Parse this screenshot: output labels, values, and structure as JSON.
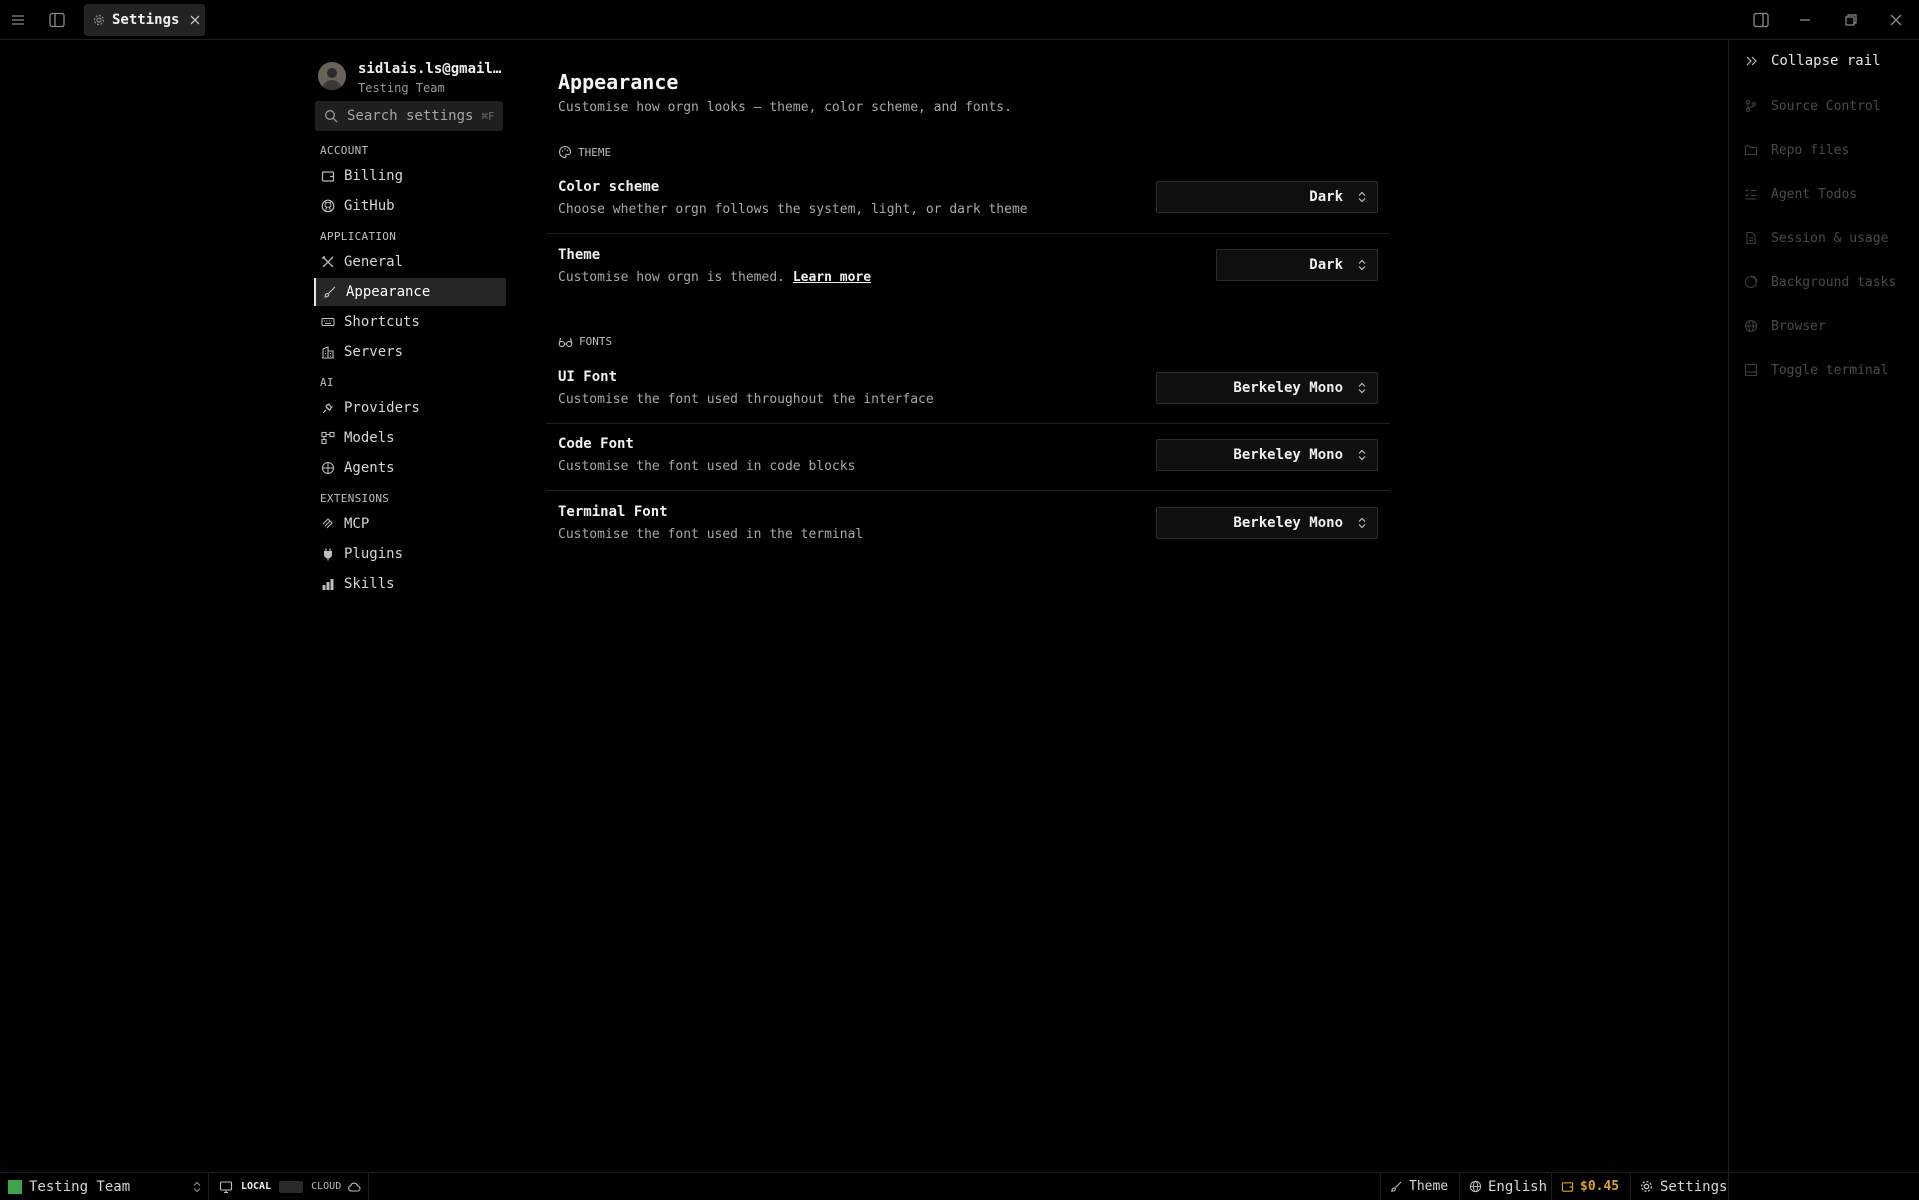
{
  "titlebar": {
    "tab_label": "Settings",
    "icons": [
      "menu-icon",
      "sidebar-toggle-icon",
      "gear-icon",
      "close-icon",
      "panel-right-icon",
      "minimize-icon",
      "restore-icon",
      "window-close-icon"
    ]
  },
  "profile": {
    "email": "sidlais.ls@gmail…",
    "team": "Testing Team"
  },
  "search": {
    "placeholder": "Search settings",
    "shortcut": "⌘F"
  },
  "nav": {
    "account_header": "ACCOUNT",
    "billing": "Billing",
    "github": "GitHub",
    "application_header": "APPLICATION",
    "general": "General",
    "appearance": "Appearance",
    "shortcuts": "Shortcuts",
    "servers": "Servers",
    "ai_header": "AI",
    "providers": "Providers",
    "models": "Models",
    "agents": "Agents",
    "extensions_header": "EXTENSIONS",
    "mcp": "MCP",
    "plugins": "Plugins",
    "skills": "Skills",
    "active": "Appearance"
  },
  "main": {
    "title": "Appearance",
    "subtitle": "Customise how orgn looks — theme, color scheme, and fonts.",
    "theme_group": "THEME",
    "color_scheme": {
      "title": "Color scheme",
      "desc": "Choose whether orgn follows the system, light, or dark theme",
      "value": "Dark"
    },
    "theme": {
      "title": "Theme",
      "desc": "Customise how orgn is themed.",
      "link": "Learn more",
      "value": "Dark"
    },
    "fonts_group": "FONTS",
    "ui_font": {
      "title": "UI Font",
      "desc": "Customise the font used throughout the interface",
      "value": "Berkeley Mono"
    },
    "code_font": {
      "title": "Code Font",
      "desc": "Customise the font used in code blocks",
      "value": "Berkeley Mono"
    },
    "terminal_font": {
      "title": "Terminal Font",
      "desc": "Customise the font used in the terminal",
      "value": "Berkeley Mono"
    }
  },
  "rail": {
    "collapse": "Collapse rail",
    "source_control": "Source Control",
    "repo_files": "Repo files",
    "agent_todos": "Agent Todos",
    "session_usage": "Session & usage",
    "background_tasks": "Background tasks",
    "browser": "Browser",
    "toggle_terminal": "Toggle terminal"
  },
  "statusbar": {
    "team": "Testing Team",
    "local": "LOCAL",
    "cloud": "CLOUD",
    "theme": "Theme",
    "language": "English",
    "cost": "$0.45",
    "settings": "Settings",
    "accent_color": "#e0a22a",
    "team_color": "#3fa34d"
  }
}
